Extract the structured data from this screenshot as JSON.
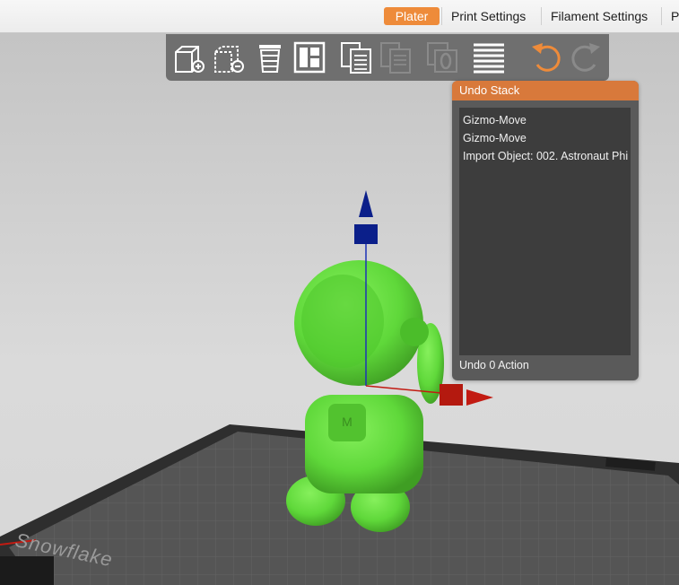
{
  "tabs": [
    {
      "label": "Plater",
      "active": true
    },
    {
      "label": "Print Settings",
      "active": false
    },
    {
      "label": "Filament Settings",
      "active": false
    },
    {
      "label": "P",
      "active": false
    }
  ],
  "toolbar": {
    "buttons": [
      {
        "icon": "add-object-icon",
        "enabled": true
      },
      {
        "icon": "remove-object-icon",
        "enabled": true
      },
      {
        "icon": "delete-all-icon",
        "enabled": true
      },
      {
        "icon": "arrange-icon",
        "enabled": true
      },
      {
        "icon": "copy-icon",
        "enabled": true
      },
      {
        "icon": "paste-icon",
        "enabled": false
      },
      {
        "icon": "instance-icon",
        "enabled": false
      },
      {
        "icon": "layers-icon",
        "enabled": true
      },
      {
        "icon": "undo-icon",
        "enabled": true
      },
      {
        "icon": "redo-icon",
        "enabled": false
      }
    ]
  },
  "undo_panel": {
    "title": "Undo Stack",
    "items": [
      "Gizmo-Move",
      "Gizmo-Move",
      "Import Object: 002. Astronaut Phi"
    ],
    "footer": "Undo 0 Action"
  },
  "bed": {
    "label": "Snowflake"
  },
  "colors": {
    "accent": "#ee8b3a",
    "model": "#5fd83a",
    "axis_x": "#c21b12",
    "axis_z": "#0b1f8a",
    "panel_bg": "#5a5a5a",
    "toolbar_bg": "#6f6f6f"
  }
}
